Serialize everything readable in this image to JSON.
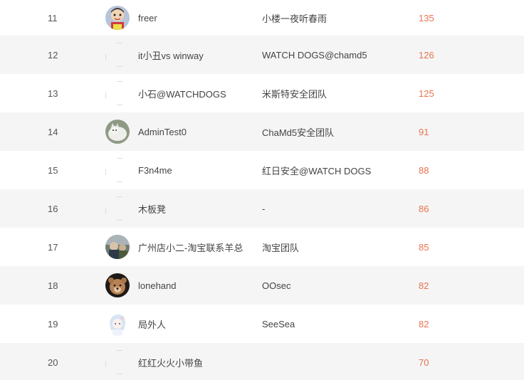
{
  "rows": [
    {
      "rank": "11",
      "avatar": "cartoon-avatar",
      "name": "freer",
      "team": "小楼一夜听春雨",
      "score": "135"
    },
    {
      "rank": "12",
      "avatar": "broken-image",
      "name": "it小丑vs winway",
      "team": "WATCH DOGS@chamd5",
      "score": "126"
    },
    {
      "rank": "13",
      "avatar": "broken-image",
      "name": "小石@WATCHDOGS",
      "team": "米斯特安全团队",
      "score": "125"
    },
    {
      "rank": "14",
      "avatar": "cat-avatar",
      "name": "AdminTest0",
      "team": "ChaMd5安全团队",
      "score": "91"
    },
    {
      "rank": "15",
      "avatar": "broken-image",
      "name": "F3n4me",
      "team": "红日安全@WATCH DOGS",
      "score": "88"
    },
    {
      "rank": "16",
      "avatar": "broken-image",
      "name": "木板凳",
      "team": "-",
      "score": "86"
    },
    {
      "rank": "17",
      "avatar": "photo-avatar",
      "name": "广州店小二-淘宝联系羊总",
      "team": "淘宝团队",
      "score": "85"
    },
    {
      "rank": "18",
      "avatar": "bear-avatar",
      "name": "lonehand",
      "team": "OOsec",
      "score": "82"
    },
    {
      "rank": "19",
      "avatar": "anime-avatar",
      "name": "局外人",
      "team": "SeeSea",
      "score": "82"
    },
    {
      "rank": "20",
      "avatar": "broken-image",
      "name": "红红火火小带鱼",
      "team": "",
      "score": "70"
    }
  ],
  "colors": {
    "score": "#e8734f",
    "alt_row": "#f5f5f5",
    "text": "#444444"
  }
}
